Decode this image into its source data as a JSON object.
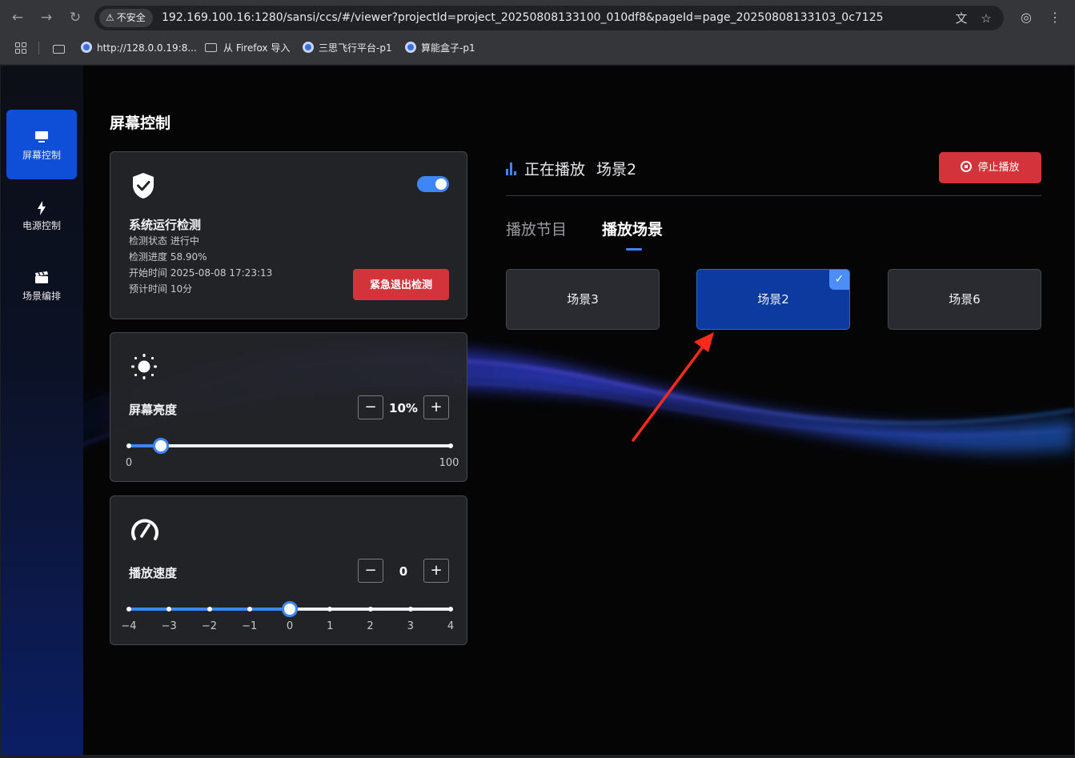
{
  "browser": {
    "security_label": "不安全",
    "url": "192.169.100.16:1280/sansi/ccs/#/viewer?projectId=project_20250808133100_010df8&pageId=page_20250808133103_0c7125",
    "bookmarks": [
      "http://128.0.0.19:8...",
      "从 Firefox 导入",
      "三思飞行平台-p1",
      "算能盒子-p1"
    ]
  },
  "sidebar": {
    "items": [
      {
        "label": "屏幕控制",
        "icon": "monitor-icon",
        "active": true
      },
      {
        "label": "电源控制",
        "icon": "bolt-icon",
        "active": false
      },
      {
        "label": "场景编排",
        "icon": "clapperboard-icon",
        "active": false
      }
    ]
  },
  "page": {
    "title": "屏幕控制"
  },
  "system_check": {
    "title": "系统运行检测",
    "enabled": true,
    "status": "检测状态 进行中",
    "progress": "检测进度 58.90%",
    "start_time": "开始时间 2025-08-08 17:23:13",
    "estimate": "预计时间 10分",
    "exit_button": "紧急退出检测"
  },
  "brightness": {
    "label": "屏幕亮度",
    "value_text": "10%",
    "value": 10,
    "min": 0,
    "max": 100,
    "min_label": "0",
    "max_label": "100",
    "minus": "−",
    "plus": "+"
  },
  "speed": {
    "label": "播放速度",
    "value_text": "0",
    "value": 0,
    "min": -4,
    "max": 4,
    "ticks": [
      "−4",
      "−3",
      "−2",
      "−1",
      "0",
      "1",
      "2",
      "3",
      "4"
    ],
    "minus": "−",
    "plus": "+"
  },
  "playback": {
    "now_playing_label": "正在播放",
    "current_scene": "场景2",
    "stop_button": "停止播放"
  },
  "tabs": [
    {
      "label": "播放节目",
      "active": false
    },
    {
      "label": "播放场景",
      "active": true
    }
  ],
  "scenes": [
    {
      "label": "场景3",
      "selected": false
    },
    {
      "label": "场景2",
      "selected": true
    },
    {
      "label": "场景6",
      "selected": false
    }
  ],
  "colors": {
    "accent": "#3e86f5",
    "danger": "#d3343b",
    "sidebar_active": "#0f4fd8",
    "selected_tile": "#0d3a9e",
    "annotation_arrow": "#ff2a1a"
  }
}
